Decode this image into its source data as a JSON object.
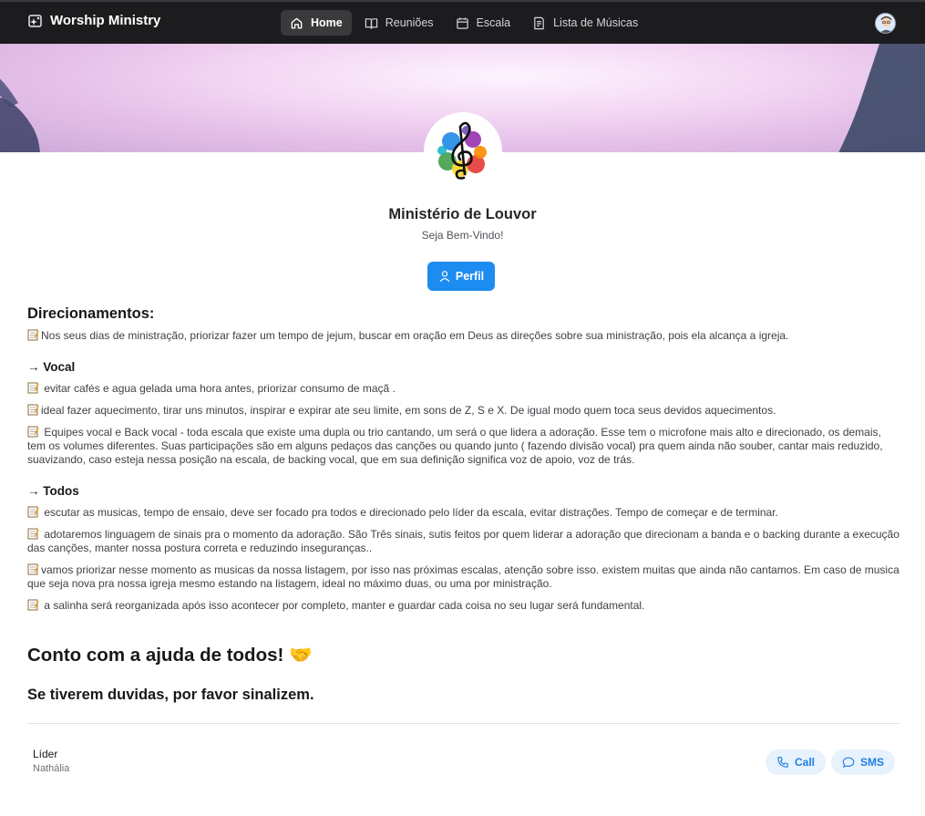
{
  "navbar": {
    "brand": "Worship Ministry",
    "items": [
      {
        "label": "Home",
        "icon": "home-icon",
        "active": true
      },
      {
        "label": "Reuniões",
        "icon": "book-open-icon",
        "active": false
      },
      {
        "label": "Escala",
        "icon": "calendar-icon",
        "active": false
      },
      {
        "label": "Lista de Músicas",
        "icon": "list-document-icon",
        "active": false
      }
    ]
  },
  "profile": {
    "title": "Ministério de Louvor",
    "subtitle": "Seja Bem-Vindo!",
    "button_label": "Perfil"
  },
  "content": {
    "heading": "Direcionamentos:",
    "intro": "Nos seus dias de ministração, priorizar fazer um tempo de jejum, buscar em oração em Deus as direções sobre sua ministração, pois ela alcança a igreja.",
    "vocal_heading": "→ Vocal",
    "vocal": [
      " evitar cafés e agua gelada uma hora antes, priorizar consumo de maçã .",
      "ideal fazer aquecimento, tirar uns minutos, inspirar e expirar ate seu limite, em sons de Z, S e X. De igual modo quem toca seus devidos aquecimentos.",
      " Equipes vocal e Back vocal - toda escala que existe uma dupla ou trio cantando, um será o que lidera a adoração. Esse tem o microfone mais alto e direcionado, os demais, tem os volumes diferentes. Suas participações são em alguns pedaços das canções ou quando junto ( fazendo divisão vocal)  pra quem ainda não souber, cantar mais reduzido, suavizando, caso esteja nessa posição na escala, de backing vocal, que em sua definição significa voz de apoio, voz de trás."
    ],
    "todos_heading": "→ Todos",
    "todos": [
      " escutar as musicas, tempo de ensaio, deve ser focado pra todos e direcionado pelo líder da escala, evitar distrações. Tempo de começar e de terminar.",
      " adotaremos linguagem de sinais pra o momento da adoração. São Três sinais, sutis feitos por quem liderar a adoração que direcionam a banda e o backing durante a execução das canções, manter nossa postura correta e reduzindo inseguranças..",
      "vamos priorizar nesse momento as musicas da nossa listagem, por isso nas próximas escalas, atenção sobre isso. existem muitas que ainda não cantamos. Em caso de musica que seja nova pra nossa igreja mesmo estando na listagem, ideal no máximo duas, ou uma por ministração.",
      " a salinha será reorganizada após isso acontecer por completo, manter e guardar cada coisa no seu lugar será fundamental."
    ],
    "closing": "Conto com a ajuda de todos! 🤝",
    "question": "Se tiverem duvidas, por favor sinalizem."
  },
  "leader": {
    "label": "Líder",
    "name": "Nathália",
    "call_label": "Call",
    "sms_label": "SMS"
  },
  "colors": {
    "navbar_bg": "#1c1c1e",
    "accent": "#1d8cf0",
    "pill_bg": "#e8f2fd"
  }
}
